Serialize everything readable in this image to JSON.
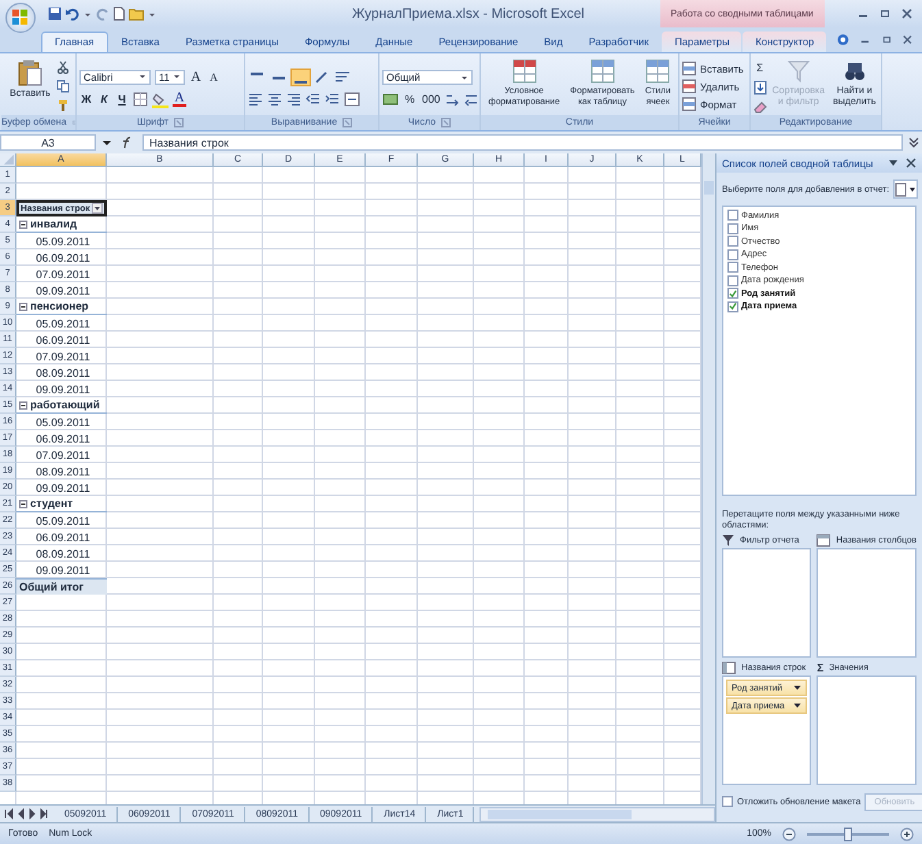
{
  "title_bar": {
    "title": "ЖурналПриема.xlsx - Microsoft Excel",
    "context_label": "Работа со сводными таблицами"
  },
  "ribbon_tabs": [
    {
      "label": "Главная",
      "selected": true
    },
    {
      "label": "Вставка",
      "selected": false
    },
    {
      "label": "Разметка страницы",
      "selected": false
    },
    {
      "label": "Формулы",
      "selected": false
    },
    {
      "label": "Данные",
      "selected": false
    },
    {
      "label": "Рецензирование",
      "selected": false
    },
    {
      "label": "Вид",
      "selected": false
    },
    {
      "label": "Разработчик",
      "selected": false
    }
  ],
  "context_tabs": [
    {
      "label": "Параметры",
      "selected": false
    },
    {
      "label": "Конструктор",
      "selected": false
    }
  ],
  "ribbon": {
    "clipboard": {
      "paste": "Вставить",
      "label": "Буфер обмена"
    },
    "font": {
      "name": "Calibri",
      "size": "11",
      "grow": "A",
      "shrink": "A",
      "bold": "Ж",
      "italic": "К",
      "underline": "Ч",
      "color_button": "A",
      "label": "Шрифт"
    },
    "alignment": {
      "vertical": [
        {
          "selected": false
        },
        {
          "selected": false
        },
        {
          "selected": true
        }
      ],
      "label": "Выравнивание"
    },
    "number": {
      "format": "Общий",
      "percent": "%",
      "thousands": "000",
      "label": "Число"
    },
    "styles": {
      "buttons": [
        "Условное форматирование",
        "Форматировать как таблицу",
        "Стили ячеек"
      ],
      "label": "Стили"
    },
    "cells": {
      "buttons": [
        "Вставить",
        "Удалить",
        "Формат"
      ],
      "label": "Ячейки"
    },
    "editing": {
      "sum": "Σ",
      "buttons": [
        {
          "label": "Сортировка и фильтр",
          "disabled": true
        },
        {
          "label": "Найти и выделить",
          "disabled": false
        }
      ],
      "label": "Редактирование"
    }
  },
  "formula_bar": {
    "name_box": "A3",
    "formula": "Названия строк"
  },
  "sheet": {
    "columns": [
      {
        "label": "A",
        "selected": true
      },
      {
        "label": "B",
        "selected": false
      },
      {
        "label": "C",
        "selected": false
      },
      {
        "label": "D",
        "selected": false
      },
      {
        "label": "E",
        "selected": false
      },
      {
        "label": "F",
        "selected": false
      },
      {
        "label": "G",
        "selected": false
      },
      {
        "label": "H",
        "selected": false
      },
      {
        "label": "I",
        "selected": false
      },
      {
        "label": "J",
        "selected": false
      },
      {
        "label": "K",
        "selected": false
      },
      {
        "label": "L",
        "selected": false
      }
    ],
    "rows": [
      {
        "number": "1",
        "selected": false
      },
      {
        "number": "2",
        "selected": false
      },
      {
        "number": "3",
        "selected": true,
        "cell": {
          "kind": "header",
          "text": "Названия строк"
        }
      },
      {
        "number": "4",
        "selected": false,
        "cell": {
          "kind": "group",
          "text": "инвалид",
          "expanded": true
        }
      },
      {
        "number": "5",
        "selected": false,
        "cell": {
          "kind": "item",
          "text": "05.09.2011"
        }
      },
      {
        "number": "6",
        "selected": false,
        "cell": {
          "kind": "item",
          "text": "06.09.2011"
        }
      },
      {
        "number": "7",
        "selected": false,
        "cell": {
          "kind": "item",
          "text": "07.09.2011"
        }
      },
      {
        "number": "8",
        "selected": false,
        "cell": {
          "kind": "item",
          "text": "09.09.2011"
        }
      },
      {
        "number": "9",
        "selected": false,
        "cell": {
          "kind": "group",
          "text": "пенсионер",
          "expanded": true
        }
      },
      {
        "number": "10",
        "selected": false,
        "cell": {
          "kind": "item",
          "text": "05.09.2011"
        }
      },
      {
        "number": "11",
        "selected": false,
        "cell": {
          "kind": "item",
          "text": "06.09.2011"
        }
      },
      {
        "number": "12",
        "selected": false,
        "cell": {
          "kind": "item",
          "text": "07.09.2011"
        }
      },
      {
        "number": "13",
        "selected": false,
        "cell": {
          "kind": "item",
          "text": "08.09.2011"
        }
      },
      {
        "number": "14",
        "selected": false,
        "cell": {
          "kind": "item",
          "text": "09.09.2011"
        }
      },
      {
        "number": "15",
        "selected": false,
        "cell": {
          "kind": "group",
          "text": "работающий",
          "expanded": true
        }
      },
      {
        "number": "16",
        "selected": false,
        "cell": {
          "kind": "item",
          "text": "05.09.2011"
        }
      },
      {
        "number": "17",
        "selected": false,
        "cell": {
          "kind": "item",
          "text": "06.09.2011"
        }
      },
      {
        "number": "18",
        "selected": false,
        "cell": {
          "kind": "item",
          "text": "07.09.2011"
        }
      },
      {
        "number": "19",
        "selected": false,
        "cell": {
          "kind": "item",
          "text": "08.09.2011"
        }
      },
      {
        "number": "20",
        "selected": false,
        "cell": {
          "kind": "item",
          "text": "09.09.2011"
        }
      },
      {
        "number": "21",
        "selected": false,
        "cell": {
          "kind": "group",
          "text": "студент",
          "expanded": true
        }
      },
      {
        "number": "22",
        "selected": false,
        "cell": {
          "kind": "item",
          "text": "05.09.2011"
        }
      },
      {
        "number": "23",
        "selected": false,
        "cell": {
          "kind": "item",
          "text": "06.09.2011"
        }
      },
      {
        "number": "24",
        "selected": false,
        "cell": {
          "kind": "item",
          "text": "08.09.2011"
        }
      },
      {
        "number": "25",
        "selected": false,
        "cell": {
          "kind": "item",
          "text": "09.09.2011"
        }
      },
      {
        "number": "26",
        "selected": false,
        "cell": {
          "kind": "total",
          "text": "Общий итог"
        }
      },
      {
        "number": "27",
        "selected": false
      },
      {
        "number": "28",
        "selected": false
      },
      {
        "number": "29",
        "selected": false
      },
      {
        "number": "30",
        "selected": false
      },
      {
        "number": "31",
        "selected": false
      },
      {
        "number": "32",
        "selected": false
      },
      {
        "number": "33",
        "selected": false
      },
      {
        "number": "34",
        "selected": false
      },
      {
        "number": "35",
        "selected": false
      },
      {
        "number": "36",
        "selected": false
      },
      {
        "number": "37",
        "selected": false
      },
      {
        "number": "38",
        "selected": false
      }
    ]
  },
  "sheet_tabs": [
    "05092011",
    "06092011",
    "07092011",
    "08092011",
    "09092011",
    "Лист14",
    "Лист1"
  ],
  "status_bar": {
    "texts": [
      "Готово",
      "Num Lock"
    ],
    "zoom": "100%",
    "zoom_slider": {
      "level": 0.5
    }
  },
  "pivot_pane": {
    "title": "Список полей сводной таблицы",
    "prompt": "Выберите поля для добавления в отчет:",
    "fields": [
      {
        "label": "Фамилия",
        "checked": false
      },
      {
        "label": "Имя",
        "checked": false
      },
      {
        "label": "Отчество",
        "checked": false
      },
      {
        "label": "Адрес",
        "checked": false
      },
      {
        "label": "Телефон",
        "checked": false
      },
      {
        "label": "Дата рождения",
        "checked": false
      },
      {
        "label": "Род занятий",
        "checked": true
      },
      {
        "label": "Дата приема",
        "checked": true
      }
    ],
    "drag_hint": "Перетащите поля между указанными ниже областями:",
    "areas": [
      {
        "kind": "filter",
        "title": "Фильтр отчета"
      },
      {
        "kind": "columns",
        "title": "Названия столбцов"
      },
      {
        "kind": "rows",
        "title": "Названия строк",
        "items": [
          "Род занятий",
          "Дата приема"
        ]
      },
      {
        "kind": "values",
        "title": "Значения",
        "symbol": "Σ"
      }
    ],
    "defer": {
      "label": "Отложить обновление макета",
      "checked": false
    },
    "update_button": {
      "label": "Обновить",
      "disabled": true
    }
  }
}
